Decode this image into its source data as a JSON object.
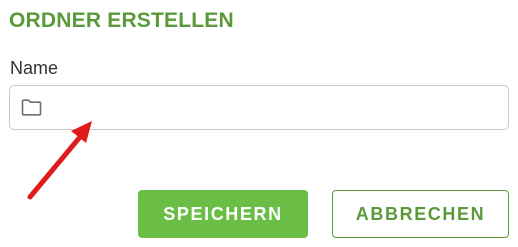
{
  "dialog": {
    "title": "ORDNER ERSTELLEN"
  },
  "form": {
    "name_label": "Name",
    "name_value": "",
    "name_icon": "folder-icon"
  },
  "buttons": {
    "save_label": "SPEICHERN",
    "cancel_label": "ABBRECHEN"
  },
  "colors": {
    "brand_green": "#5a9a3a",
    "primary_button": "#6abd45",
    "annotation_arrow": "#e01b1b"
  }
}
